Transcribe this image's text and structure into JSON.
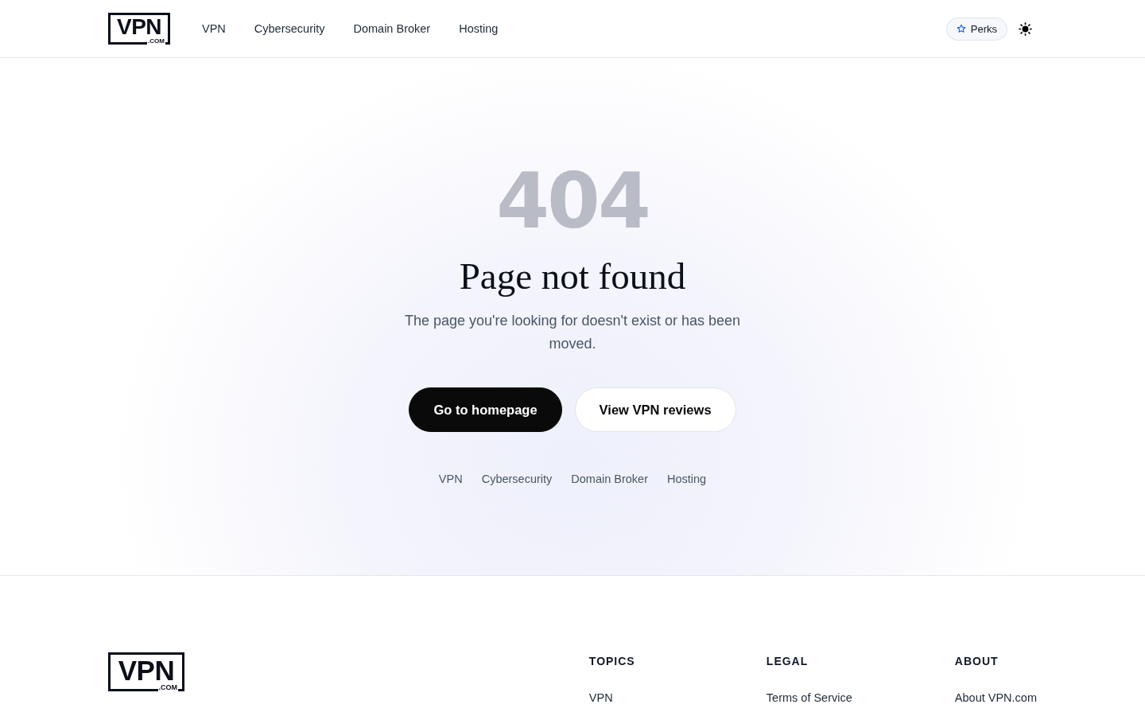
{
  "header": {
    "logo": {
      "text": "VPN",
      "suffix": ".COM"
    },
    "nav": [
      "VPN",
      "Cybersecurity",
      "Domain Broker",
      "Hosting"
    ],
    "perks_button": "Perks"
  },
  "error": {
    "code": "404",
    "title": "Page not found",
    "message": "The page you're looking for doesn't exist or has been moved.",
    "buttons": [
      {
        "label": "Go to homepage",
        "kind": "primary"
      },
      {
        "label": "View VPN reviews",
        "kind": "secondary"
      }
    ],
    "links": [
      "VPN",
      "Cybersecurity",
      "Domain Broker",
      "Hosting"
    ]
  },
  "footer": {
    "logo": {
      "text": "VPN",
      "suffix": ".COM"
    },
    "columns": [
      {
        "heading": "TOPICS",
        "links": [
          "VPN"
        ]
      },
      {
        "heading": "LEGAL",
        "links": [
          "Terms of Service"
        ]
      },
      {
        "heading": "ABOUT",
        "links": [
          "About VPN.com"
        ]
      }
    ]
  }
}
